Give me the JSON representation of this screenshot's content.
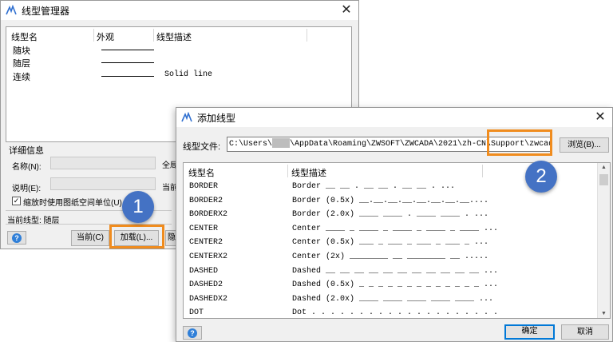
{
  "back_dialog": {
    "title": "线型管理器",
    "columns": [
      "线型名",
      "外观",
      "线型描述"
    ],
    "rows": [
      {
        "name": "随块",
        "description": ""
      },
      {
        "name": "随层",
        "description": ""
      },
      {
        "name": "连续",
        "description": "Solid line"
      }
    ],
    "details_label": "详细信息",
    "name_label": "名称(N):",
    "desc_label": "说明(E):",
    "global_label": "全局",
    "current_label": "当前",
    "checkbox_label": "缩放时使用图纸空间单位(U)",
    "checkbox_checked": true,
    "current_linetype": "当前线型: 随层",
    "btn_current": "当前(C)",
    "btn_load": "加载(L)...",
    "btn_hide": "隐"
  },
  "front_dialog": {
    "title": "添加线型",
    "file_label": "线型文件:",
    "file_path_prefix": "C:\\Users\\",
    "file_path_suffix": "\\AppData\\Roaming\\ZWSOFT\\ZWCADA\\2021\\zh-CN\\Support\\zwcadiso.lin",
    "browse_label": "浏览(B)...",
    "columns": [
      "线型名",
      "线型描述"
    ],
    "linetypes": [
      {
        "name": "BORDER",
        "description": "Border __ __ . __ __ . __ __ . ..."
      },
      {
        "name": "BORDER2",
        "description": "Border (0.5x) __.__.__.__.__.__.__.__...."
      },
      {
        "name": "BORDERX2",
        "description": "Border (2.0x) ____ ____ . ____ ____ . ..."
      },
      {
        "name": "CENTER",
        "description": "Center ____ _ ____ _ ____ _ ____ _ ____ ..."
      },
      {
        "name": "CENTER2",
        "description": "Center (0.5x) ___ _ ___ _ ___ _ ___ _ ..."
      },
      {
        "name": "CENTERX2",
        "description": "Center (2x) ________ __ ________ __ ....."
      },
      {
        "name": "DASHED",
        "description": "Dashed __ __ __ __ __ __ __ __ __ __ __ ..."
      },
      {
        "name": "DASHED2",
        "description": "Dashed (0.5x) _ _ _ _ _ _ _ _ _ _ _ _ _ ..."
      },
      {
        "name": "DASHEDX2",
        "description": "Dashed (2.0x) ____ ____ ____ ____ ____ ..."
      },
      {
        "name": "DOT",
        "description": "Dot . . . . . . . . . . . . . . . . . . . ."
      }
    ],
    "ok_label": "确定",
    "cancel_label": "取消"
  },
  "annotations": {
    "badge_1": "1",
    "badge_2": "2",
    "highlight_color": "#f08c1e",
    "badge_color": "#4472c4"
  }
}
